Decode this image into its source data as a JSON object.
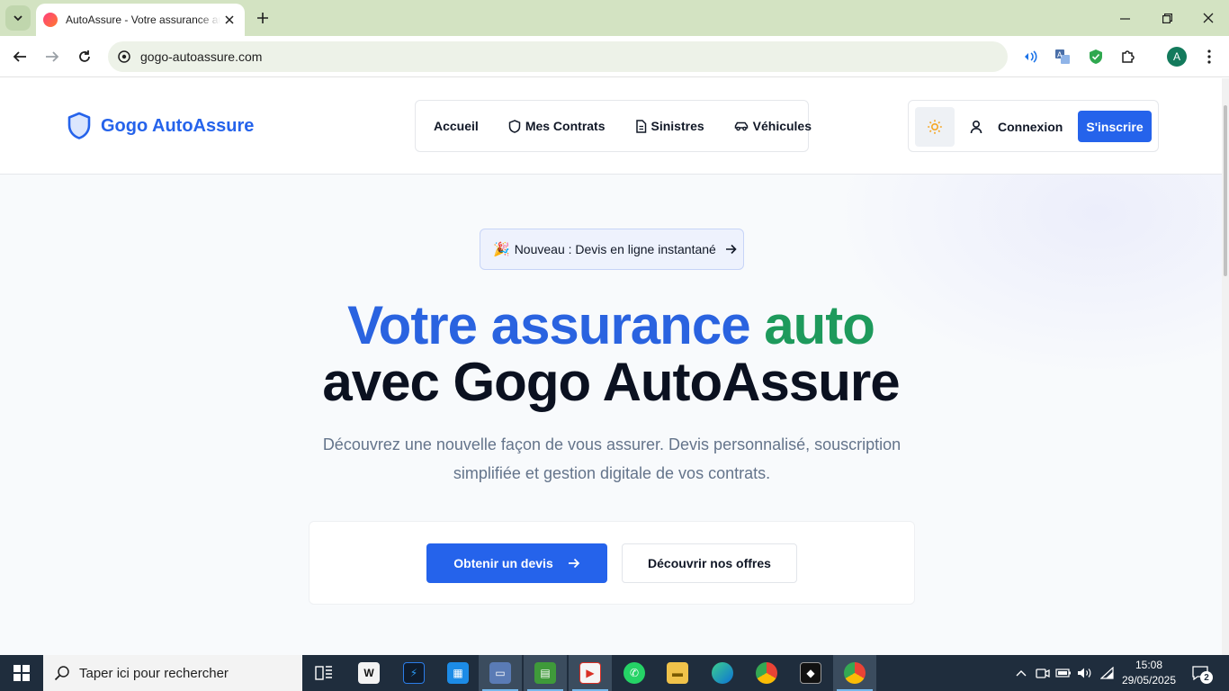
{
  "browser": {
    "tab_title": "AutoAssure - Votre assurance auto",
    "url": "gogo-autoassure.com",
    "profile_initial": "A"
  },
  "site": {
    "brand": "Gogo AutoAssure",
    "nav": [
      {
        "label": "Accueil",
        "icon": "none"
      },
      {
        "label": "Mes Contrats",
        "icon": "shield-icon"
      },
      {
        "label": "Sinistres",
        "icon": "document-icon"
      },
      {
        "label": "Véhicules",
        "icon": "car-icon"
      }
    ],
    "login_label": "Connexion",
    "signup_label": "S'inscrire",
    "theme_icon": "sun-icon"
  },
  "hero": {
    "announcement": "Nouveau : Devis en ligne instantané",
    "announcement_emoji": "🎉",
    "title_part1": "Votre assurance",
    "title_part2": "auto",
    "title_line2": "avec Gogo AutoAssure",
    "subtitle": "Découvrez une nouvelle façon de vous assurer. Devis personnalisé, souscription simplifiée et gestion digitale de vos contrats.",
    "cta_primary": "Obtenir un devis",
    "cta_secondary": "Découvrir nos offres"
  },
  "taskbar": {
    "search_placeholder": "Taper ici pour rechercher",
    "time": "15:08",
    "date": "29/05/2025",
    "notification_count": "2"
  },
  "colors": {
    "accent": "#2563eb",
    "accent_green": "#1e9a5c",
    "tab_strip": "#d3e3c2",
    "taskbar": "#1f2d3d"
  }
}
